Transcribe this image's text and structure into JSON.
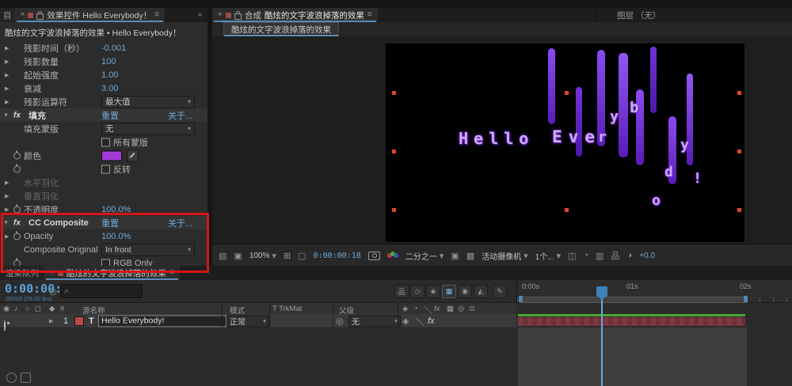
{
  "colors": {
    "accent_blue": "#6fa9d6",
    "annotation_red": "#d51518",
    "fill_swatch": "#a43bd8",
    "layer_label_chip": "#b94a4a",
    "canvas_text_purple": "#d2a8ff",
    "streak_purple": "#6a23cf",
    "selection_handle_red": "#da452c",
    "cache_green": "#46a72e",
    "layer_bar_maroon": "#7c3a42"
  },
  "icons": {
    "close": "×",
    "menu": "≡",
    "overflow": "»",
    "twirl_closed": "▶",
    "twirl_open": "▼",
    "chevron_down": "▾",
    "pickwhip": "◎",
    "audio": "♪",
    "solo": "○",
    "search": "⌕",
    "text_layer": "T"
  },
  "effects_panel": {
    "window_tab": "目",
    "tab": "效果控件 Hello Everybody！",
    "breadcrumb": "酷炫的文字波浪掉落的效果 • Hello Everybody！",
    "echo": {
      "time_label": "残影时间（秒）",
      "time_value": "-0.001",
      "count_label": "残影数量",
      "count_value": "100",
      "intensity_label": "起始强度",
      "intensity_value": "1.00",
      "decay_label": "衰减",
      "decay_value": "3.00",
      "operator_label": "残影运算符",
      "operator_value": "最大值"
    },
    "fill": {
      "name": "填充",
      "reset": "重置",
      "about": "关于...",
      "mask_label": "填充蒙版",
      "mask_value": "无",
      "all_masks_label": "所有蒙版",
      "color_label": "颜色",
      "invert_label": "反转",
      "h_feather_label": "水平羽化",
      "v_feather_label": "垂直羽化",
      "opacity_label": "不透明度",
      "opacity_value": "100.0%"
    },
    "cc": {
      "name": "CC Composite",
      "reset": "重置",
      "about": "关于...",
      "opacity_label": "Opacity",
      "opacity_value": "100.0%",
      "original_label": "Composite Original",
      "original_value": "In front",
      "rgb_label": "RGB Only"
    }
  },
  "comp_panel": {
    "tab_type": "合成",
    "tab_name": "酷炫的文字波浪掉落的效果",
    "layer_tab": "图层 （无）",
    "nav_tab": "酷炫的文字波浪掉落的效果",
    "canvas": {
      "word1": "Hello",
      "word2": "Eve",
      "letters": [
        "r",
        "y",
        "b",
        "y",
        "d",
        "o",
        "!"
      ]
    },
    "toolbar": {
      "zoom": "100%",
      "timecode": "0:00:00:18",
      "resolution": "二分之一",
      "view": "活动摄像机",
      "layout": "1个...",
      "exposure": "+0.0"
    }
  },
  "timeline": {
    "render_queue_tab": "渲染队列",
    "comp_tab": "酷炫的文字波浪掉落的效果",
    "timecode": "0:00:00:18",
    "frames": "00018 (25.00 fps)",
    "columns": {
      "hash": "#",
      "source": "源名称",
      "mode": "模式",
      "trkmat": "T TrkMat",
      "parent": "父级"
    },
    "layer": {
      "index": "1",
      "name": "Hello Everybody!",
      "mode": "正常",
      "parent": "无"
    },
    "ruler": [
      "0:00s",
      "01s",
      "02s"
    ]
  }
}
